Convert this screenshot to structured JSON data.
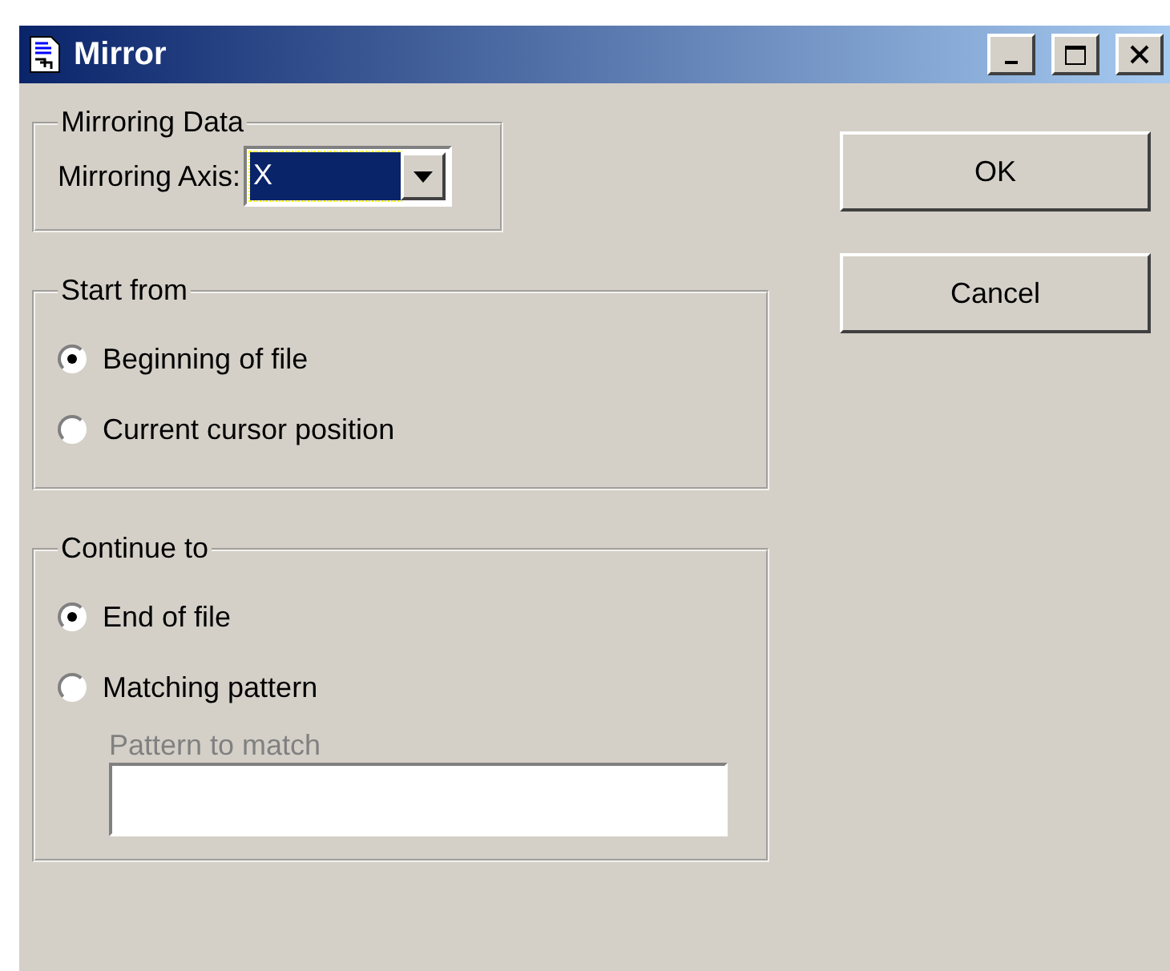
{
  "window": {
    "title": "Mirror"
  },
  "mirroring_data": {
    "title": "Mirroring Data",
    "axis_label": "Mirroring Axis:",
    "axis_value": "X",
    "focused": true
  },
  "start_from": {
    "title": "Start from",
    "options": [
      {
        "label": "Beginning of file",
        "selected": true
      },
      {
        "label": "Current cursor position",
        "selected": false
      }
    ]
  },
  "continue_to": {
    "title": "Continue to",
    "options": [
      {
        "label": "End of file",
        "selected": true
      },
      {
        "label": "Matching pattern",
        "selected": false
      }
    ],
    "pattern": {
      "label": "Pattern to match",
      "disabled": true
    }
  },
  "buttons": [
    {
      "label": "OK"
    },
    {
      "label": "Cancel"
    }
  ]
}
